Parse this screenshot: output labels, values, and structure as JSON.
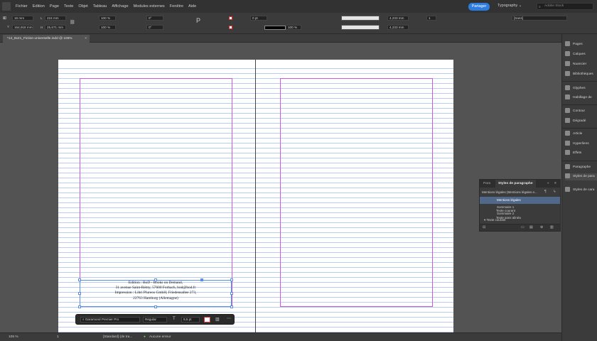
{
  "menubar": {
    "items": [
      "Fichier",
      "Edition",
      "Page",
      "Texte",
      "Objet",
      "Tableau",
      "Affichage",
      "Modules externes",
      "Fenêtre",
      "Aide"
    ],
    "share_label": "Partager",
    "workspace_label": "Typography",
    "search_placeholder": "Adobe Stock"
  },
  "control": {
    "x": "16 mm",
    "y": "164,918 mm",
    "w": "224 mm",
    "h": "25,671 mm",
    "scale_x": "100 %",
    "scale_y": "100 %",
    "angle": "0°",
    "shear": "0°",
    "stroke_weight": "0 pt",
    "opacity": "100 %",
    "gutter_top": "4,233 mm",
    "gutter_bottom": "4,233 mm",
    "columns": "1",
    "style_field": "[Sans]"
  },
  "tab": {
    "title": "*14_8x21_Fiction universelle.indd @ 105%"
  },
  "colophon": {
    "lines": [
      "Edition : BoD - Books on Demand,",
      "31 avenue Saint-Rémy, 57600 Forbach, bod@bod.fr",
      "Impression : Libri Plureos GmbH, Friedensallee 273,",
      "22763 Hamburg (Allemagne)"
    ]
  },
  "selection_toolbar": {
    "font": "Garamond Premier Pro",
    "style": "Regular",
    "size": "9,5 pt"
  },
  "statusbar": {
    "zoom": "105 %",
    "page": "1",
    "preflight_profile": "[Standard] (de tra...",
    "preflight_status": "Aucune erreur"
  },
  "dock": {
    "items": [
      "Pages",
      "Calques",
      "Nuancier",
      "Bibliothèques",
      "Glyphes",
      "Habillage de",
      "Contour",
      "Dégradé",
      "Article",
      "Hyperliens",
      "Effets",
      "Paragraphe",
      "Styles de para",
      "Styles de cara"
    ]
  },
  "panel": {
    "tab_inactive": "Para",
    "tab_active": "Styles de paragraphe",
    "header": "Mentions légales (Mentions légales e...",
    "rows": [
      {
        "label": "Mentions légales",
        "selected": true,
        "indent": 1
      },
      {
        "label": "Sommaire 1",
        "selected": false,
        "indent": 1
      },
      {
        "label": "Sommaire 2",
        "selected": false,
        "indent": 1
      },
      {
        "label": "Texte courant",
        "selected": false,
        "indent": 0
      },
      {
        "label": "Texte courant",
        "selected": false,
        "indent": 1
      },
      {
        "label": "Texte sans alinéa",
        "selected": false,
        "indent": 1
      }
    ]
  },
  "colors": {
    "accent": "#2d7de0",
    "margin_guide": "#c95bdc",
    "baseline_grid": "#b8cdef",
    "selection": "#5b8fe3"
  }
}
